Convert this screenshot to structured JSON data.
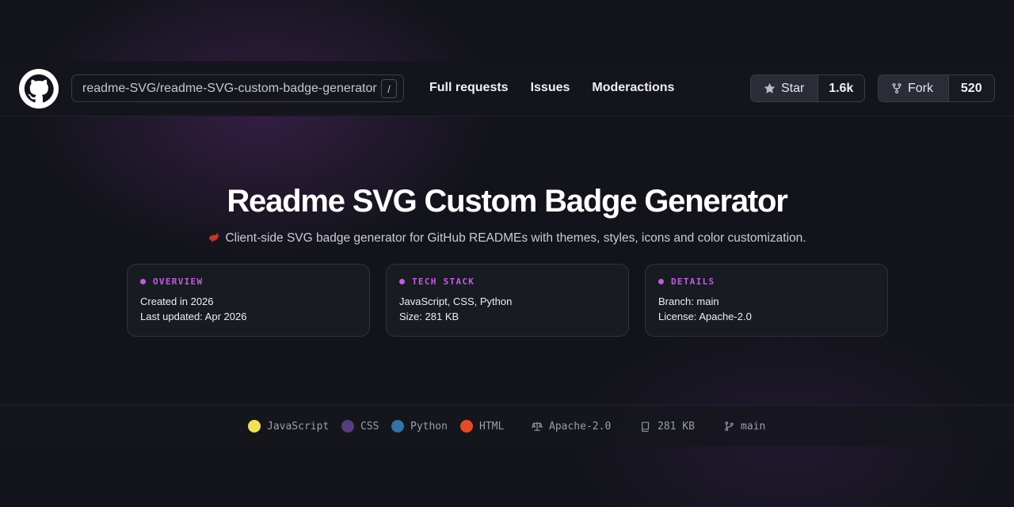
{
  "header": {
    "repo_path": "readme-SVG/readme-SVG-custom-badge-generator",
    "slash_key": "/",
    "nav": [
      "Full requests",
      "Issues",
      "Moderactions"
    ],
    "star_label": "Star",
    "star_count": "1.6k",
    "fork_label": "Fork",
    "fork_count": "520"
  },
  "hero": {
    "title": "Readme SVG Custom Badge Generator",
    "subtitle": "Client-side SVG badge generator for GitHub READMEs with themes, styles, icons and color customization."
  },
  "cards": [
    {
      "label": "OVERVIEW",
      "lines": [
        "Created in 2026",
        "Last updated: Apr 2026"
      ]
    },
    {
      "label": "TECH STACK",
      "lines": [
        "JavaScript, CSS, Python",
        "Size: 281 KB"
      ]
    },
    {
      "label": "DETAILS",
      "lines": [
        "Branch: main",
        "License: Apache-2.0"
      ]
    }
  ],
  "footer": {
    "languages": [
      {
        "name": "JavaScript",
        "color": "#f1e05a"
      },
      {
        "name": "CSS",
        "color": "#563d7c"
      },
      {
        "name": "Python",
        "color": "#3572a5"
      },
      {
        "name": "HTML",
        "color": "#e34c26"
      }
    ],
    "license": "Apache-2.0",
    "size": "281 KB",
    "branch": "main"
  },
  "colors": {
    "accent": "#c25ce0",
    "background": "#13141b"
  },
  "icons": [
    "github-logo-icon",
    "star-icon",
    "fork-icon",
    "bird-icon",
    "scale-icon",
    "repo-icon",
    "branch-icon"
  ]
}
